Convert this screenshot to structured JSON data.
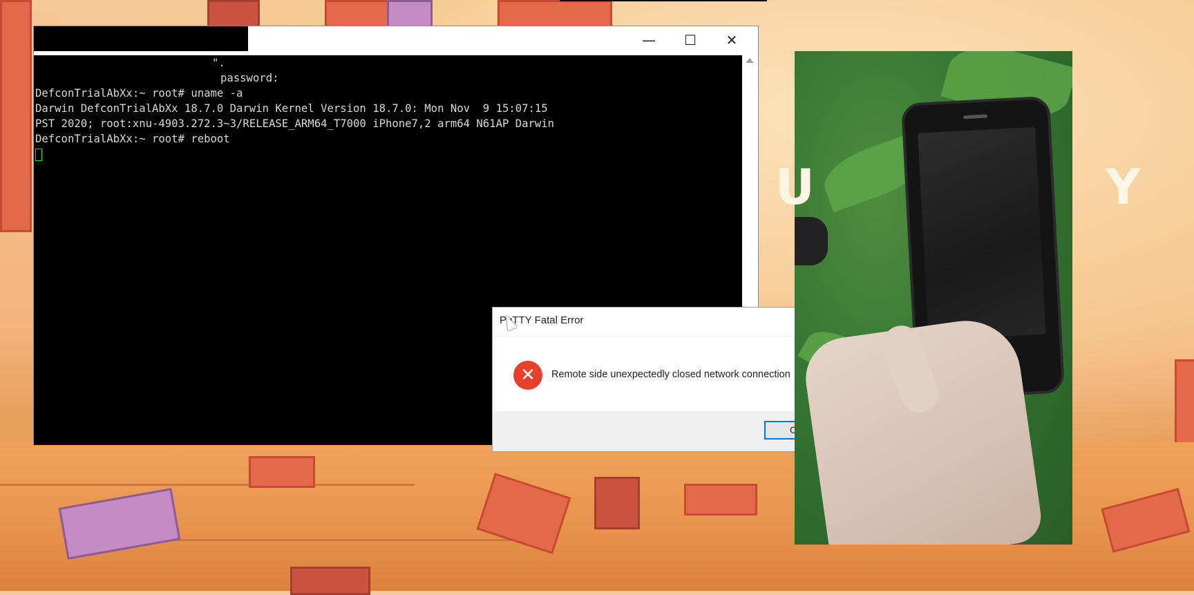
{
  "terminal_window": {
    "title_redacted": true,
    "controls": {
      "minimize": "—",
      "maximize": "☐",
      "close": "✕"
    },
    "lines": [
      "\".",
      "password:",
      "DefconTrialAbXx:~ root# uname -a",
      "Darwin DefconTrialAbXx 18.7.0 Darwin Kernel Version 18.7.0: Mon Nov  9 15:07:15",
      "PST 2020; root:xnu-4903.272.3~3/RELEASE_ARM64_T7000 iPhone7,2 arm64 N61AP Darwin",
      "DefconTrialAbXx:~ root# reboot"
    ],
    "cursor_color": "#2fd32f"
  },
  "error_dialog": {
    "title": "PuTTY Fatal Error",
    "message": "Remote side unexpectedly closed network connection",
    "icon": "error-x-icon",
    "ok_label": "OK",
    "accent": "#0078d7"
  },
  "camera_overlay": {
    "overlay_text_left": "U",
    "overlay_text_right": "Y"
  }
}
